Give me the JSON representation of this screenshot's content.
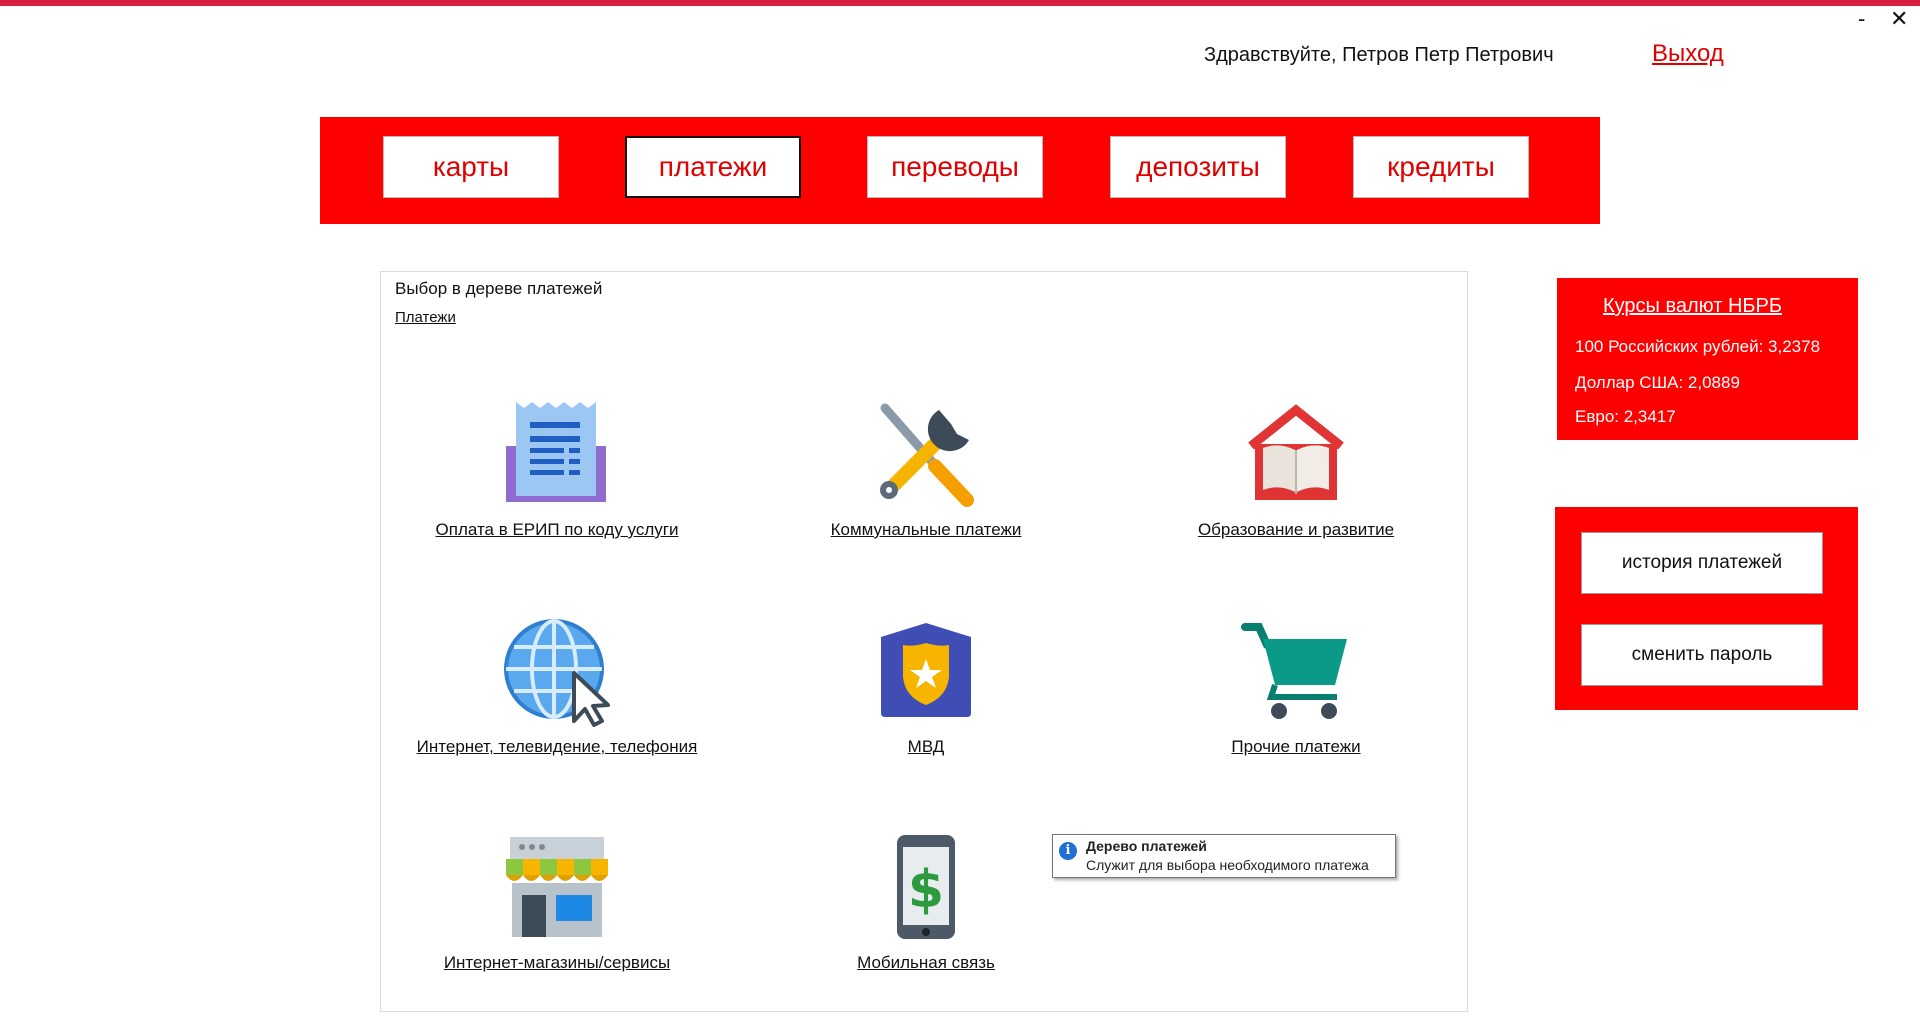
{
  "window": {
    "minimize": "-",
    "close": "✕"
  },
  "header": {
    "greeting": "Здравствуйте, Петров Петр Петрович",
    "logout": "Выход"
  },
  "nav": {
    "items": [
      "карты",
      "платежи",
      "переводы",
      "депозиты",
      "кредиты"
    ],
    "active": "платежи"
  },
  "panel": {
    "title": "Выбор в дереве платежей",
    "breadcrumb": "Платежи",
    "tiles": [
      {
        "label": "Оплата в ЕРИП по коду услуги",
        "icon": "receipt-icon"
      },
      {
        "label": "Коммунальные платежи",
        "icon": "tools-icon"
      },
      {
        "label": "Образование и развитие",
        "icon": "book-icon"
      },
      {
        "label": "Интернет, телевидение, телефония",
        "icon": "globe-cursor-icon"
      },
      {
        "label": "МВД",
        "icon": "police-badge-icon"
      },
      {
        "label": "Прочие платежи",
        "icon": "shopping-cart-icon"
      },
      {
        "label": "Интернет-магазины/сервисы",
        "icon": "shop-icon"
      },
      {
        "label": "Мобильная связь",
        "icon": "mobile-dollar-icon"
      }
    ]
  },
  "tooltip": {
    "title": "Дерево платежей",
    "text": "Служит для выбора необходимого платежа",
    "icon": "info-icon"
  },
  "rates": {
    "title": "Курсы валют НБРБ",
    "lines": [
      "100 Российских рублей: 3,2378",
      "Доллар США: 2,0889",
      "Евро: 2,3417"
    ]
  },
  "actions": {
    "history": "история платежей",
    "change_password": "сменить пароль"
  },
  "colors": {
    "brand_red": "#ff0000",
    "text_red": "#e00000",
    "top_line": "#d61f3c"
  }
}
